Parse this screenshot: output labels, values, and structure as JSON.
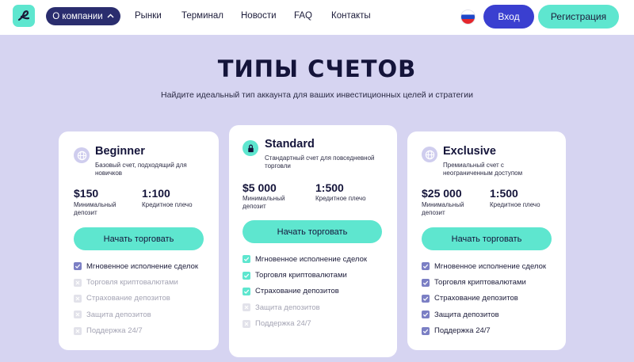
{
  "header": {
    "nav_pill": "О компании",
    "nav": [
      "Рынки",
      "Терминал",
      "Новости",
      "FAQ",
      "Контакты"
    ],
    "login": "Вход",
    "register": "Регистрация"
  },
  "colors": {
    "accent_teal": "#5ee6cf",
    "primary_blue": "#3a3fd0",
    "navy": "#2a2d6e",
    "bg_lavender": "#d6d4f1"
  },
  "icons": {
    "logo": "brand-logo",
    "flag": "russian-flag-icon",
    "pill_chevron": "chevron-up-icon"
  },
  "page": {
    "title": "ТИПЫ СЧЕТОВ",
    "subtitle": "Найдите идеальный тип аккаунта для ваших инвестиционных целей и стратегии"
  },
  "cards": [
    {
      "name": "Beginner",
      "icon": "globe-icon",
      "desc1": "Базовый счет, подходящий для",
      "desc2": "новичков",
      "deposit": "$150",
      "deposit_lbl1": "Минимальный",
      "deposit_lbl2": "депозит",
      "leverage": "1:100",
      "leverage_lbl": "Кредитное плечо",
      "cta": "Начать торговать",
      "features": [
        {
          "text": "Мгновенное исполнение сделок",
          "on": true
        },
        {
          "text": "Торговля криптовалютами",
          "on": false
        },
        {
          "text": "Страхование депозитов",
          "on": false
        },
        {
          "text": "Защита депозитов",
          "on": false
        },
        {
          "text": "Поддержка 24/7",
          "on": false
        }
      ]
    },
    {
      "name": "Standard",
      "icon": "lock-icon",
      "desc1": "Стандартный счет для повседневной",
      "desc2": "торговли",
      "deposit": "$5 000",
      "deposit_lbl1": "Минимальный",
      "deposit_lbl2": "депозит",
      "leverage": "1:500",
      "leverage_lbl": "Кредитное плечо",
      "cta": "Начать торговать",
      "features": [
        {
          "text": "Мгновенное исполнение сделок",
          "on": true
        },
        {
          "text": "Торговля криптовалютами",
          "on": true
        },
        {
          "text": "Страхование депозитов",
          "on": true
        },
        {
          "text": "Защита депозитов",
          "on": false
        },
        {
          "text": "Поддержка 24/7",
          "on": false
        }
      ]
    },
    {
      "name": "Exclusive",
      "icon": "globe-icon",
      "desc1": "Премиальный счет с",
      "desc2": "неограниченным доступом",
      "deposit": "$25 000",
      "deposit_lbl1": "Минимальный",
      "deposit_lbl2": "депозит",
      "leverage": "1:500",
      "leverage_lbl": "Кредитное плечо",
      "cta": "Начать торговать",
      "features": [
        {
          "text": "Мгновенное исполнение сделок",
          "on": true
        },
        {
          "text": "Торговля криптовалютами",
          "on": true
        },
        {
          "text": "Страхование депозитов",
          "on": true
        },
        {
          "text": "Защита депозитов",
          "on": true
        },
        {
          "text": "Поддержка 24/7",
          "on": true
        }
      ]
    }
  ]
}
